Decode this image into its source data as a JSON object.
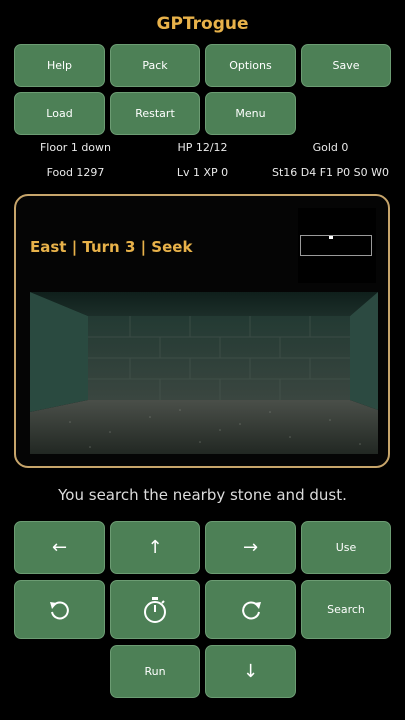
{
  "app": {
    "title": "GPTrogue"
  },
  "top_buttons": {
    "help": "Help",
    "pack": "Pack",
    "options": "Options",
    "save": "Save",
    "load": "Load",
    "restart": "Restart",
    "menu": "Menu"
  },
  "stats": {
    "floor": "Floor 1 down",
    "hp": "HP 12/12",
    "gold": "Gold 0",
    "food": "Food 1297",
    "level": "Lv 1 XP 0",
    "attributes": "St16 D4 F1 P0 S0 W0"
  },
  "hud": {
    "status": "East | Turn 3 | Seek"
  },
  "message": "You search the nearby stone and dust.",
  "controls": {
    "left": "←",
    "up": "↑",
    "right": "→",
    "use": "Use",
    "search": "Search",
    "run": "Run",
    "down": "↓",
    "rotate_left_icon": "rotate-left-icon",
    "wait_icon": "stopwatch-icon",
    "rotate_right_icon": "rotate-right-icon"
  },
  "colors": {
    "button": "#4d8056",
    "accent": "#e8b24a",
    "frame": "#c7a56b",
    "background": "#000000"
  }
}
